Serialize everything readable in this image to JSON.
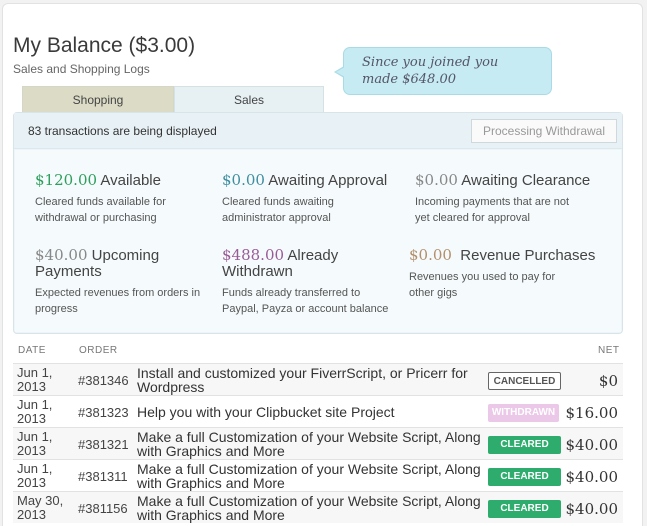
{
  "header": {
    "title": "My Balance ($3.00)",
    "subtitle": "Sales and Shopping Logs"
  },
  "bubble": {
    "line1": "Since you joined you",
    "line2_prefix": "made ",
    "line2_amount": "$648.00"
  },
  "tabs": [
    {
      "label": "Shopping",
      "active": false
    },
    {
      "label": "Sales",
      "active": true
    }
  ],
  "toolbar": {
    "count_text": "83 transactions are being displayed",
    "withdraw_label": "Processing Withdrawal"
  },
  "stats": [
    {
      "amount": "$120.00",
      "label": " Available",
      "desc": "Cleared funds available for withdrawal or purchasing",
      "color": "#2e9f5e"
    },
    {
      "amount": "$0.00",
      "label": " Awaiting Approval",
      "desc": "Cleared funds awaiting administrator approval",
      "color": "#3e8ea0"
    },
    {
      "amount": "$0.00",
      "label": " Awaiting Clearance",
      "desc": "Incoming payments that are not yet cleared for approval",
      "color": "#888888"
    },
    {
      "amount": "$40.00",
      "label": " Upcoming Payments",
      "desc": "Expected revenues from orders in progress",
      "color": "#888888"
    },
    {
      "amount": "$488.00",
      "label": " Already Withdrawn",
      "desc": "Funds already transferred to Paypal, Payza or account balance",
      "color": "#9a5c97"
    },
    {
      "amount": "$0.00",
      "label": "  Revenue Purchases",
      "desc": "Revenues you used to pay for other gigs",
      "color": "#b3906b"
    }
  ],
  "table": {
    "headers": {
      "date": "DATE",
      "order": "ORDER",
      "net": "NET"
    },
    "rows": [
      {
        "date": "Jun 1, 2013",
        "order": "#381346",
        "desc": "Install and customized your FiverrScript, or Pricerr for Wordpress",
        "status": "CANCELLED",
        "net": "$0"
      },
      {
        "date": "Jun 1, 2013",
        "order": "#381323",
        "desc": "Help you with your Clipbucket site Project",
        "status": "WITHDRAWN",
        "net": "$16.00"
      },
      {
        "date": "Jun 1, 2013",
        "order": "#381321",
        "desc": "Make a full Customization of your Website Script, Along with Graphics and More",
        "status": "CLEARED",
        "net": "$40.00"
      },
      {
        "date": "Jun 1, 2013",
        "order": "#381311",
        "desc": "Make a full Customization of your Website Script, Along with Graphics and More",
        "status": "CLEARED",
        "net": "$40.00"
      },
      {
        "date": "May 30, 2013",
        "order": "#381156",
        "desc": "Make a full Customization of your Website Script, Along with Graphics and More",
        "status": "CLEARED",
        "net": "$40.00"
      }
    ]
  },
  "colors": {
    "available": "#2e9f5e",
    "awaiting_approval": "#3e8ea0",
    "withdrawn": "#9a5c97",
    "purchases": "#b3906b",
    "cleared_badge": "#2dac6d",
    "withdrawn_badge": "#ebc7e8",
    "bubble": "#c6ebf3"
  }
}
